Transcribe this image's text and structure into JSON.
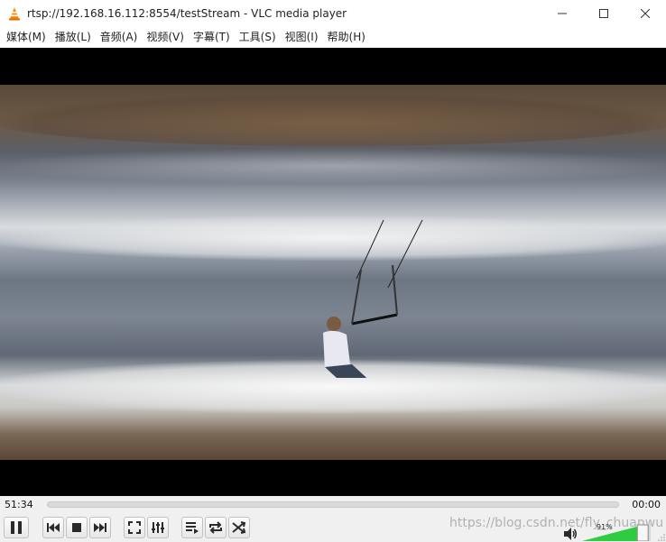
{
  "window": {
    "title": "rtsp://192.168.16.112:8554/testStream - VLC media player"
  },
  "menu": {
    "items": [
      {
        "label": "媒体(M)"
      },
      {
        "label": "播放(L)"
      },
      {
        "label": "音频(A)"
      },
      {
        "label": "视频(V)"
      },
      {
        "label": "字幕(T)"
      },
      {
        "label": "工具(S)"
      },
      {
        "label": "视图(I)"
      },
      {
        "label": "帮助(H)"
      }
    ]
  },
  "playback": {
    "elapsed": "51:34",
    "remaining": "00:00",
    "progress": 0
  },
  "volume": {
    "label": "91%",
    "level": 0.91
  },
  "watermark": "https://blog.csdn.net/fly_chuanwu",
  "colors": {
    "accent_volume": "#2ecc40",
    "video_bg": "#000000",
    "chrome_bg": "#f0f0f0"
  },
  "icons": {
    "app": "vlc-cone-icon",
    "minimize": "minimize-icon",
    "maximize": "maximize-icon",
    "close": "close-icon",
    "pause": "pause-icon",
    "previous": "previous-icon",
    "stop": "stop-icon",
    "next": "next-icon",
    "fullscreen": "fullscreen-icon",
    "extended": "extended-settings-icon",
    "playlist": "playlist-icon",
    "loop": "loop-icon",
    "shuffle": "shuffle-icon",
    "volume": "speaker-icon"
  }
}
